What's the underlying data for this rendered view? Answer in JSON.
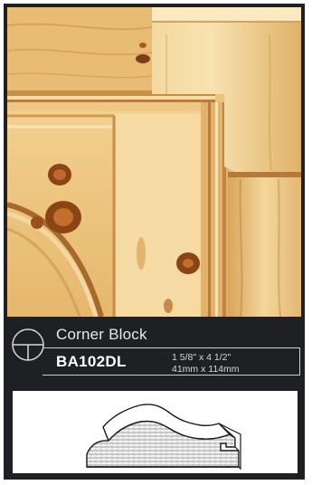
{
  "product": {
    "name": "Corner Block",
    "sku": "BA102DL",
    "size_imperial": "1 5/8\" x 4 1/2\"",
    "size_metric": "41mm x 114mm"
  },
  "photo": {
    "subject": "pine corner block moulding",
    "wood_light": "#e9c47b",
    "wood_mid": "#d9a655",
    "wood_dark": "#b9782f",
    "knot_color": "#8a4416"
  },
  "icons": {
    "logo": "circle-t-logo-icon"
  },
  "colors": {
    "panel_bg": "#1f2024",
    "text": "#e8e8e8",
    "profile_bg": "#ffffff"
  }
}
